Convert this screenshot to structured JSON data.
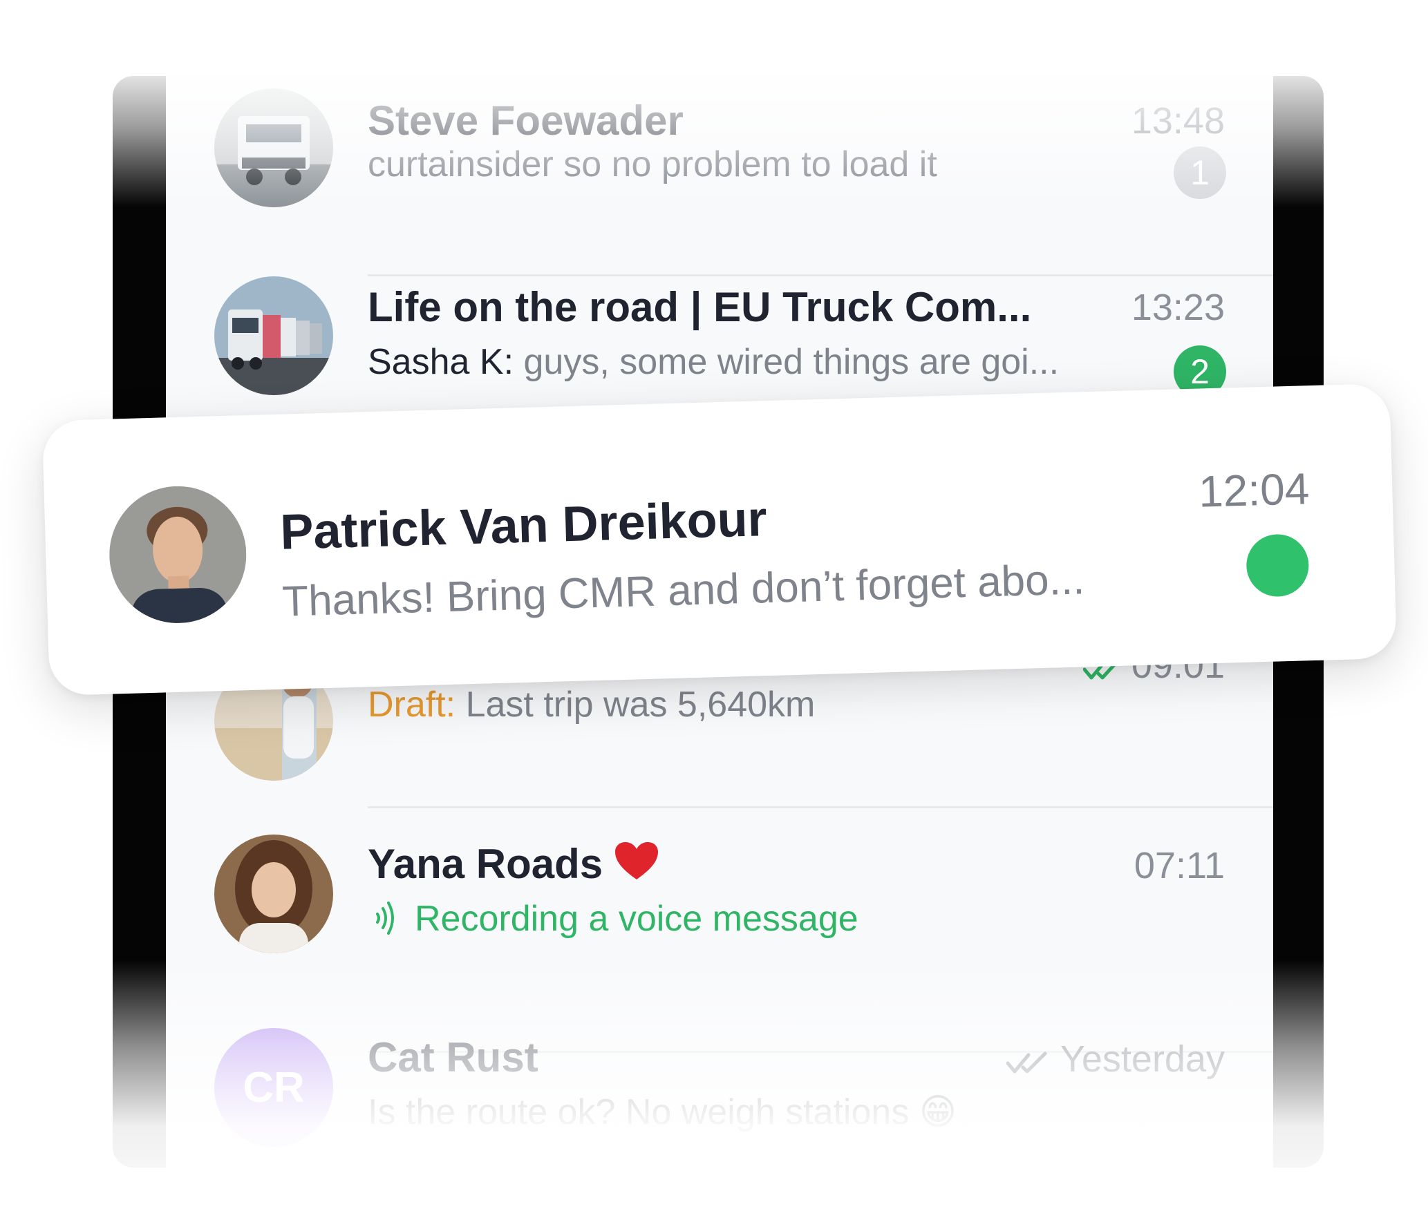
{
  "chats": [
    {
      "name": "Steve Foewader",
      "time": "13:48",
      "preview": "curtainsider so no problem to load it",
      "unread": "1",
      "avatar": "truck-photo",
      "muted": true
    },
    {
      "name": "Life on the road | EU Truck Com...",
      "time": "13:23",
      "sender": "Sasha K:",
      "preview": "guys, some wired things are goi...",
      "unread": "2",
      "avatar": "truck-convoy-photo"
    },
    {
      "name": "",
      "time": "09:01",
      "draft_label": "Draft:",
      "preview": "Last trip was 5,640km",
      "avatar": "person-beach-photo",
      "status": "read-checks-icon"
    },
    {
      "name": "Yana Roads",
      "name_emoji": "heart-icon",
      "time": "07:11",
      "preview": "Recording a voice message",
      "avatar": "woman-portrait-photo",
      "status": "voice-wave-icon"
    },
    {
      "name": "Cat Rust",
      "initials": "CR",
      "time": "Yesterday",
      "preview": "Is the route ok? No weigh stations 😁",
      "status": "read-checks-icon"
    }
  ],
  "pinned": {
    "name": "Patrick Van Dreikour",
    "time": "12:04",
    "preview": "Thanks! Bring CMR and don’t forget abo...",
    "status": "online-dot",
    "avatar": "man-portrait-photo"
  },
  "colors": {
    "accent_green": "#2fb565",
    "draft_orange": "#e89a2f",
    "text_dark": "#1f2430",
    "text_muted": "#7f838c",
    "avatar_purple": "#b99bf2"
  }
}
